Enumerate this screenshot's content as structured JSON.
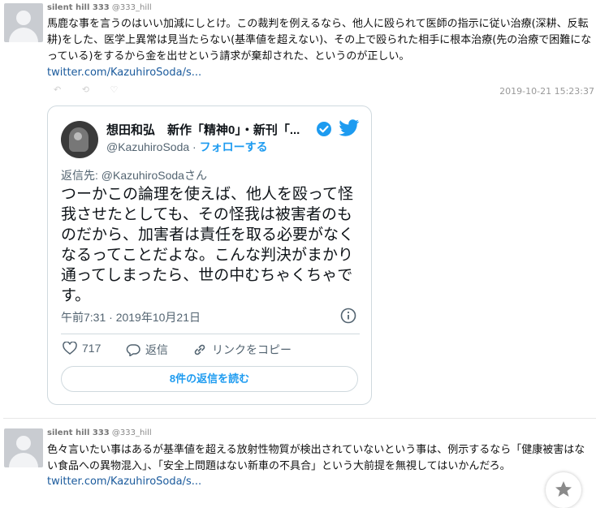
{
  "post1": {
    "username": "silent hill 333",
    "handle": "@333_hill",
    "text": "馬鹿な事を言うのはいい加減にしとけ。この裁判を例えるなら、他人に殴られて医師の指示に従い治療(深耕、反転耕)をした、医学上異常は見当たらない(基準値を超えない)、その上で殴られた相手に根本治療(先の治療で困難になっている)をするから金を出せという請求が棄却された、というのが正しい。",
    "link": "twitter.com/KazuhiroSoda/s...",
    "timestamp": "2019-10-21 15:23:37"
  },
  "embed": {
    "name": "想田和弘　新作「精神0」・新刊「...",
    "handle": "@KazuhiroSoda",
    "handle_sep": " · ",
    "follow": "フォローする",
    "reply_to": "返信先: @KazuhiroSodaさん",
    "body": "つーかこの論理を使えば、他人を殴って怪我させたとしても、その怪我は被害者のものだから、加害者は責任を取る必要がなくなるってことだよな。こんな判決がまかり通ってしまったら、世の中むちゃくちゃです。",
    "time": "午前7:31 · 2019年10月21日",
    "likes": "717",
    "reply_label": "返信",
    "copy_link_label": "リンクをコピー",
    "read_replies": "8件の返信を読む"
  },
  "post2": {
    "username": "silent hill 333",
    "handle": "@333_hill",
    "text": "色々言いたい事はあるが基準値を超える放射性物質が検出されていないという事は、例示するなら「健康被害はない食品への異物混入」、「安全上問題はない新車の不具合」という大前提を無視してはいかんだろ。",
    "link": "twitter.com/KazuhiroSoda/s..."
  },
  "colors": {
    "link": "#1a5a9c",
    "twitter_blue": "#1d9bf0",
    "border": "#cfd9de"
  }
}
